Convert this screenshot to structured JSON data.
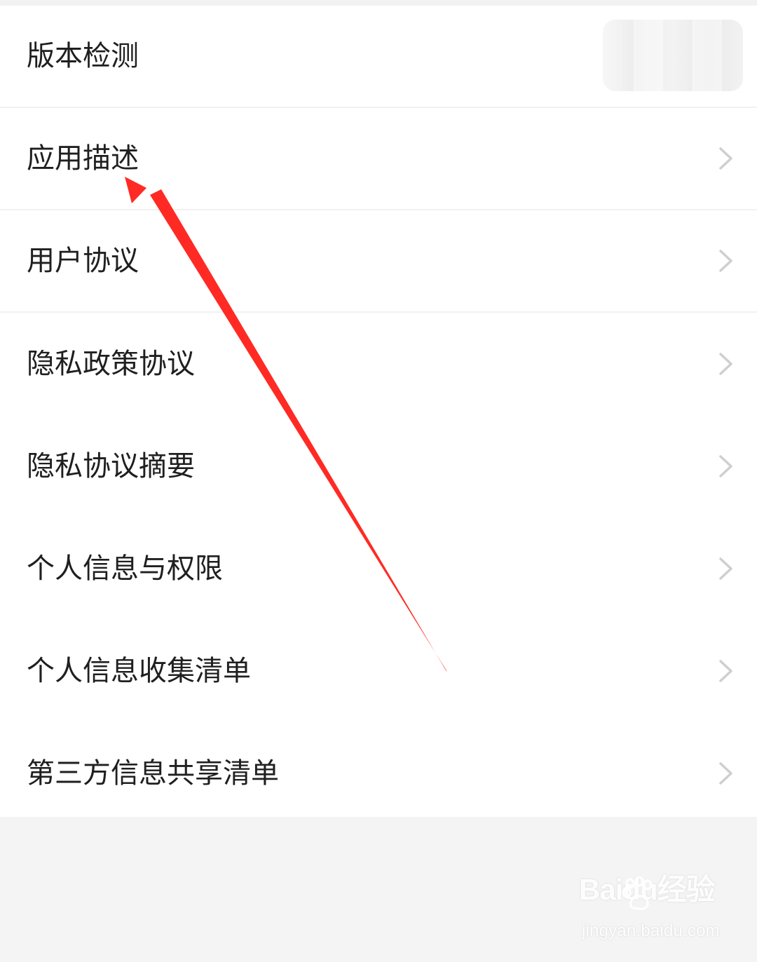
{
  "settings_list": {
    "items": [
      {
        "label": "版本检测",
        "has_chevron": false
      },
      {
        "label": "应用描述",
        "has_chevron": true
      },
      {
        "label": "用户协议",
        "has_chevron": true
      },
      {
        "label": "隐私政策协议",
        "has_chevron": true
      },
      {
        "label": "隐私协议摘要",
        "has_chevron": true
      },
      {
        "label": "个人信息与权限",
        "has_chevron": true
      },
      {
        "label": "个人信息收集清单",
        "has_chevron": true
      },
      {
        "label": "第三方信息共享清单",
        "has_chevron": true
      }
    ]
  },
  "watermark": {
    "logo_text": "Baidu经验",
    "site_text": "jingyan.baidu.com"
  },
  "icons": {
    "chevron": "chevron-right-icon",
    "annotation_arrow": "arrow-icon"
  },
  "colors": {
    "background": "#f4f4f4",
    "list_background": "#ffffff",
    "text": "#1f1f1f",
    "chevron": "#cfcfcf",
    "divider": "#f1f1f1",
    "annotation": "#ff2a24"
  }
}
